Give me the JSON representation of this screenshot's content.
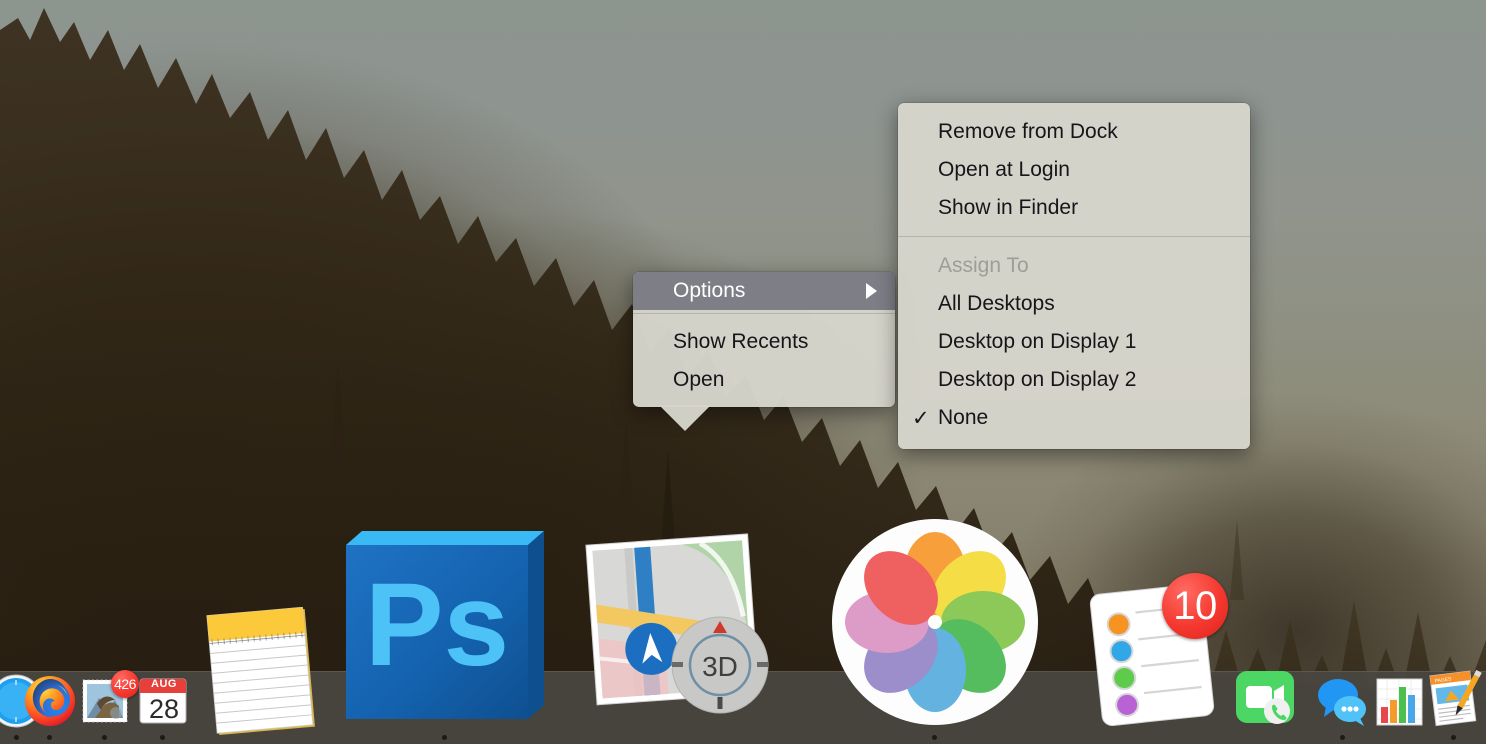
{
  "desktop": {
    "wallpaper_name": "forest-sunset-wallpaper",
    "sky_color": "#8e9490",
    "forest_color": "#2a2114"
  },
  "context_menu": {
    "name": "dock-context-menu",
    "items": [
      {
        "label": "Options",
        "highlighted": true,
        "has_submenu": true,
        "arrow": "submenu-arrow-icon"
      },
      {
        "label": "Show Recents",
        "highlighted": false,
        "has_submenu": false
      },
      {
        "label": "Open",
        "highlighted": false,
        "has_submenu": false
      }
    ]
  },
  "submenu": {
    "name": "options-submenu",
    "groups": [
      {
        "items": [
          {
            "label": "Remove from Dock",
            "checked": false,
            "disabled": false
          },
          {
            "label": "Open at Login",
            "checked": false,
            "disabled": false
          },
          {
            "label": "Show in Finder",
            "checked": false,
            "disabled": false
          }
        ]
      },
      {
        "items": [
          {
            "label": "Assign To",
            "checked": false,
            "disabled": true
          },
          {
            "label": "All Desktops",
            "checked": false,
            "disabled": false
          },
          {
            "label": "Desktop on Display 1",
            "checked": false,
            "disabled": false
          },
          {
            "label": "Desktop on Display 2",
            "checked": false,
            "disabled": false
          },
          {
            "label": "None",
            "checked": true,
            "disabled": false,
            "check_mark": "✓"
          }
        ]
      }
    ]
  },
  "dock": {
    "name": "macos-dock",
    "background_color": "#4a4641",
    "items": [
      {
        "name": "safari",
        "label": "Safari",
        "running": false,
        "badge": null
      },
      {
        "name": "firefox",
        "label": "Firefox",
        "running": true,
        "badge": null
      },
      {
        "name": "mail",
        "label": "Mail",
        "running": true,
        "badge": "426"
      },
      {
        "name": "calendar",
        "label": "Calendar",
        "running": true,
        "badge": null,
        "month": "AUG",
        "day": "28"
      },
      {
        "name": "notes",
        "label": "Notes",
        "running": false,
        "badge": null
      },
      {
        "name": "photoshop",
        "label": "Adobe Photoshop",
        "running": true,
        "badge": null,
        "glyph": "Ps"
      },
      {
        "name": "maps",
        "label": "Maps",
        "running": false,
        "badge": null,
        "glyph": "3D"
      },
      {
        "name": "photos",
        "label": "Photos",
        "running": true,
        "badge": null
      },
      {
        "name": "reminders",
        "label": "Reminders",
        "running": false,
        "badge": "10"
      },
      {
        "name": "facetime",
        "label": "FaceTime",
        "running": false,
        "badge": null
      },
      {
        "name": "messages",
        "label": "Messages",
        "running": true,
        "badge": null
      },
      {
        "name": "numbers",
        "label": "Numbers",
        "running": false,
        "badge": null
      },
      {
        "name": "pages",
        "label": "Pages",
        "running": true,
        "badge": null,
        "glyph": "PAGES"
      }
    ]
  }
}
